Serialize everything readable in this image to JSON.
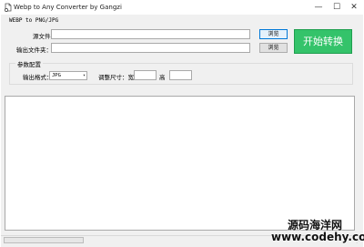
{
  "window": {
    "title": "Webp to Any Converter by Gangzi",
    "minimize_glyph": "—",
    "maximize_glyph": "☐",
    "close_glyph": "✕",
    "icon": "app-icon"
  },
  "header": {
    "subtitle": "WEBP to PNG/JPG"
  },
  "source": {
    "label": "源文件夹：",
    "value": "",
    "browse_label": "浏览"
  },
  "output": {
    "label": "输出文件夹：",
    "value": "",
    "browse_label": "浏览"
  },
  "start_button": {
    "label": "开始转换",
    "color": "#34c36a"
  },
  "params": {
    "group_title": "参数配置",
    "format_label": "输出格式：",
    "format_value": "JPG",
    "resize_label": "调整尺寸：宽",
    "width_value": "",
    "height_label": "高",
    "height_value": ""
  },
  "log": {
    "text": ""
  },
  "progress": {
    "value": 0
  },
  "watermark": {
    "line1": "源码海洋网",
    "line2": "www.codehy.com"
  }
}
